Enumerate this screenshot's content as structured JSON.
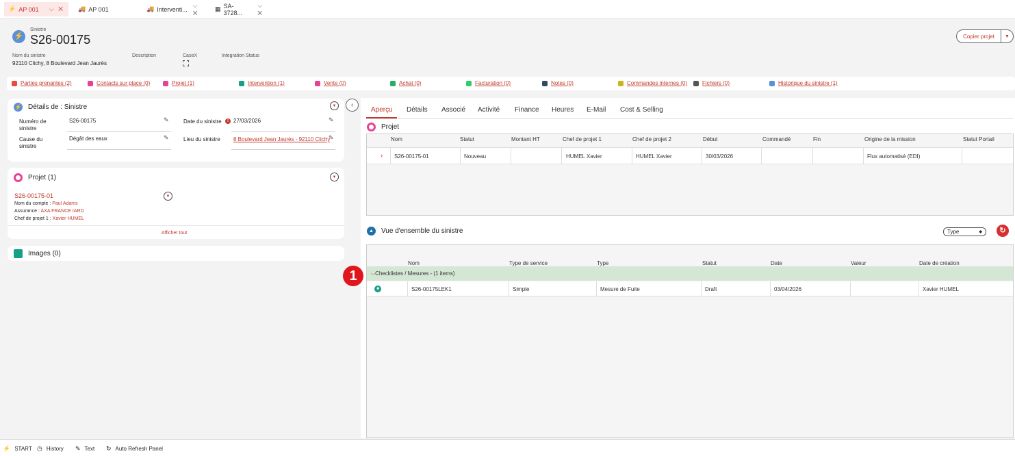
{
  "tabs": [
    {
      "label": "AP 001",
      "icon": "bolt-icon",
      "active": true
    },
    {
      "label": "AP 001",
      "icon": "truck-icon"
    },
    {
      "label": "Interventi...",
      "icon": "truck-icon"
    },
    {
      "label": "SA-3728...",
      "icon": "document-icon"
    }
  ],
  "header": {
    "subtitle": "Sinistre",
    "title": "S26-00175",
    "fields": [
      {
        "label": "Nom du sinistre",
        "value": "92110 Clichy, 8 Boulevard Jean Jaurès"
      },
      {
        "label": "Description",
        "value": ""
      },
      {
        "label": "CaseX",
        "value": ""
      },
      {
        "label": "Integration Status",
        "value": ""
      }
    ],
    "copy_button": "Copier projet"
  },
  "links": [
    {
      "label": "Parties prenantes (2)",
      "color": "#e74c3c"
    },
    {
      "label": "Contacts sur place (0)",
      "color": "#e84393"
    },
    {
      "label": "Projet (1)",
      "color": "#e84393"
    },
    {
      "label": "Intervention (1)",
      "color": "#16a085"
    },
    {
      "label": "Vente (0)",
      "color": "#e84393"
    },
    {
      "label": "Achat (0)",
      "color": "#27ae60"
    },
    {
      "label": "Facturation (0)",
      "color": "#2ecc71"
    },
    {
      "label": "Notes (0)",
      "color": "#34495e"
    },
    {
      "label": "Commandes internes (0)",
      "color": "#c9b31e"
    },
    {
      "label": "Fichiers (0)",
      "color": "#555555"
    },
    {
      "label": "Historique du sinistre (1)",
      "color": "#5b8fd9"
    }
  ],
  "details": {
    "title": "Détails de : Sinistre",
    "numero_label": "Numéro de sinistre",
    "numero_value": "S26-00175",
    "cause_label": "Cause du sinistre",
    "cause_value": "Dégât des eaux",
    "date_label": "Date du sinistre",
    "date_value": "27/03/2026",
    "lieu_label": "Lieu du sinistre",
    "lieu_value": "8 Boulevard Jean Jaurès - 92110 Clichy"
  },
  "projet_card": {
    "title": "Projet (1)",
    "item_name": "S26-00175-01",
    "compte_label": "Nom du compte : ",
    "compte_value": "Paul Adams",
    "assurance_label": "Assurance : ",
    "assurance_value": "AXA FRANCE IARD",
    "chef_label": "Chef de projet 1 : ",
    "chef_value": "Xavier HUMEL",
    "show_all": "Afficher tout"
  },
  "images_card": {
    "title": "Images (0)"
  },
  "right_tabs": [
    "Aperçu",
    "Détails",
    "Associé",
    "Activité",
    "Finance",
    "Heures",
    "E-Mail",
    "Cost & Selling"
  ],
  "projet_grid": {
    "title": "Projet",
    "headers": [
      "Nom",
      "Statut",
      "Montant HT",
      "Chef de projet 1",
      "Chef de projet 2",
      "Début",
      "Commandé",
      "Fin",
      "Origine de la mission",
      "Statut Portail"
    ],
    "rows": [
      [
        "S26-00175-01",
        "Nouveau",
        "",
        "HUMEL Xavier",
        "HUMEL Xavier",
        "30/03/2026",
        "",
        "",
        "Flux automatisé (EDI)",
        ""
      ]
    ]
  },
  "overview": {
    "title": "Vue d'ensemble du sinistre",
    "type_select": "Type",
    "headers": [
      "Nom",
      "Type de service",
      "Type",
      "Statut",
      "Date",
      "Valeur",
      "Date de création"
    ],
    "group_label": "Checklistes / Mesures - (1 items)",
    "rows": [
      [
        "S26-00175LEK1",
        "Simple",
        "Mesure de Fuite",
        "Draft",
        "03/04/2026",
        "",
        "Xavier HUMEL"
      ]
    ]
  },
  "callout": "1",
  "bottom_bar": [
    {
      "label": "START",
      "icon": "bolt-icon"
    },
    {
      "label": "History",
      "icon": "clock-icon"
    },
    {
      "label": "Text",
      "icon": "pencil-icon"
    },
    {
      "label": "Auto Refresh Panel",
      "icon": "refresh-icon"
    }
  ]
}
